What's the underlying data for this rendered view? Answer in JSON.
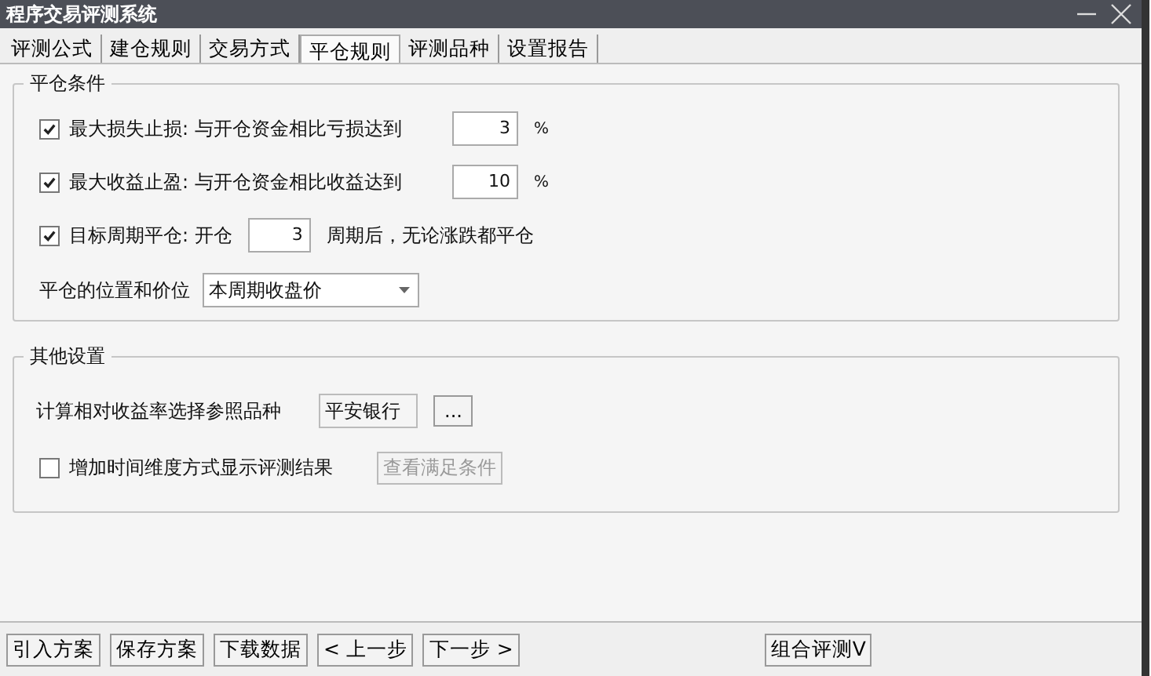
{
  "window": {
    "title": "程序交易评测系统"
  },
  "tabs": [
    {
      "label": "评测公式",
      "selected": false
    },
    {
      "label": "建仓规则",
      "selected": false
    },
    {
      "label": "交易方式",
      "selected": false
    },
    {
      "label": "平仓规则",
      "selected": true
    },
    {
      "label": "评测品种",
      "selected": false
    },
    {
      "label": "设置报告",
      "selected": false
    }
  ],
  "close_conditions": {
    "title": "平仓条件",
    "rules": [
      {
        "kind": "threshold",
        "checked": true,
        "label": "最大损失止损: 与开仓资金相比亏损达到",
        "value": "3",
        "suffix": "%"
      },
      {
        "kind": "threshold",
        "checked": true,
        "label": "最大收益止盈: 与开仓资金相比收益达到",
        "value": "10",
        "suffix": "%"
      },
      {
        "kind": "inline",
        "checked": true,
        "label": "目标周期平仓: 开仓",
        "value": "3",
        "suffix": "周期后，无论涨跌都平仓"
      }
    ],
    "price": {
      "label": "平仓的位置和价位",
      "value": "本周期收盘价"
    }
  },
  "other_settings": {
    "title": "其他设置",
    "reference": {
      "label": "计算相对收益率选择参照品种",
      "value": "平安银行",
      "button": "..."
    },
    "time_dimension": {
      "checked": false,
      "label": "增加时间维度方式显示评测结果",
      "button": "查看满足条件",
      "button_disabled": true
    }
  },
  "footer_buttons": [
    {
      "label": "引入方案"
    },
    {
      "label": "保存方案"
    },
    {
      "label": "下载数据"
    },
    {
      "label": "< 上一步"
    },
    {
      "label": "下一步 >"
    }
  ],
  "footer_right_button": {
    "label": "组合评测V"
  }
}
